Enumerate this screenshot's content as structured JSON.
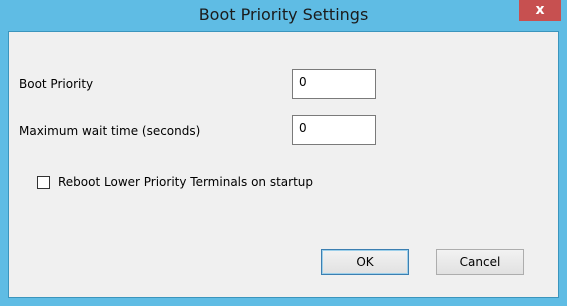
{
  "window": {
    "title": "Boot Priority Settings",
    "close_glyph": "x"
  },
  "form": {
    "boot_priority": {
      "label": "Boot Priority",
      "value": "0"
    },
    "max_wait": {
      "label": "Maximum wait time (seconds)",
      "value": "0"
    },
    "reboot_checkbox": {
      "label": "Reboot Lower Priority Terminals on startup",
      "checked": false
    }
  },
  "buttons": {
    "ok_label": "OK",
    "cancel_label": "Cancel"
  },
  "colors": {
    "frame": "#5fbce4",
    "close_button": "#c75050",
    "client_background": "#f0f0f0"
  }
}
